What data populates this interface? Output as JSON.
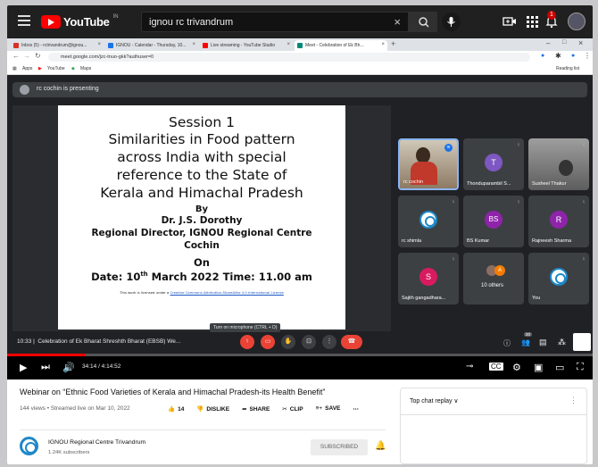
{
  "youtube": {
    "logo_text": "YouTube",
    "country_code": "IN",
    "search_value": "ignou rc trivandrum",
    "clear_glyph": "×",
    "notification_count": "1"
  },
  "browser": {
    "tabs": [
      {
        "label": "Inbox (5) - rctrivandrum@ignou...",
        "color": "#d93025"
      },
      {
        "label": "IGNOU - Calendar - Thursday, 10...",
        "color": "#1a73e8"
      },
      {
        "label": "Live streaming - YouTube Studio",
        "color": "#ff0000"
      },
      {
        "label": "Meet - Celebration of Ek Bh...",
        "color": "#00897b"
      }
    ],
    "address": "meet.google.com/jzc-tnuo-gkk?authuser=0",
    "bookmarks": [
      "Apps",
      "YouTube",
      "Maps"
    ],
    "reading_list": "Reading list"
  },
  "meet": {
    "presenting_text": "rc cochin is presenting",
    "slide": {
      "session": "Session 1",
      "title_lines": [
        "Similarities in Food pattern",
        "across India with special",
        "reference to the State of",
        "Kerala and Himachal Pradesh"
      ],
      "by": "By",
      "speaker": "Dr. J.S. Dorothy",
      "role": "Regional Director, IGNOU Regional Centre",
      "place": "Cochin",
      "on": "On",
      "date_prefix": "Date: 10",
      "date_sup": "th",
      "date_suffix": " March 2022 Time: 11.00 am",
      "license_prefix": "This work is licensed under a ",
      "license_link": "Creative Commons Attribution-ShareAlike 4.0 International License"
    },
    "participants": [
      {
        "name": "rc cochin",
        "kind": "video",
        "color": "#7a5a3a"
      },
      {
        "name": "Thonduparambil S...",
        "initial": "T",
        "color": "#7e57c2"
      },
      {
        "name": "Susheel Thakur",
        "kind": "video",
        "color": "#6b6b6b"
      },
      {
        "name": "rc shimla",
        "kind": "logo"
      },
      {
        "name": "BS Kumar",
        "initial": "BS",
        "color": "#8e24aa"
      },
      {
        "name": "Rajneesh Sharma",
        "initial": "R",
        "color": "#8e24aa"
      },
      {
        "name": "Sajith gangadhara...",
        "initial": "S",
        "color": "#d81b60"
      },
      {
        "name": "10 others",
        "kind": "others",
        "color": "#f57c00"
      },
      {
        "name": "You",
        "kind": "logo"
      }
    ],
    "meeting_time": "10:33",
    "meeting_title": "Celebration of Ek Bharat Shreshth Bharat (EBSB) We...",
    "tooltip": "Turn on microphone (CTRL + D)",
    "participant_count": "20"
  },
  "player": {
    "time": "34:14 / 4:14:52",
    "progress": 0.134
  },
  "video": {
    "title": "Webinar on “Ethnic Food Varieties of Kerala and Himachal Pradesh-its Health Benefit”",
    "meta": "144 views • Streamed live on Mar 10, 2022",
    "likes": "14",
    "dislike": "DISLIKE",
    "share": "SHARE",
    "clip": "CLIP",
    "save": "SAVE",
    "more": "⋯",
    "channel_name": "IGNOU Regional Centre Trivandrum",
    "channel_subs": "1.24K subscribers",
    "subscribe_label": "SUBSCRIBED",
    "chat_header": "Top chat replay ∨"
  },
  "colors": {
    "youtube_red": "#ff0000",
    "meet_bg": "#202124",
    "end_call": "#ea4335"
  }
}
